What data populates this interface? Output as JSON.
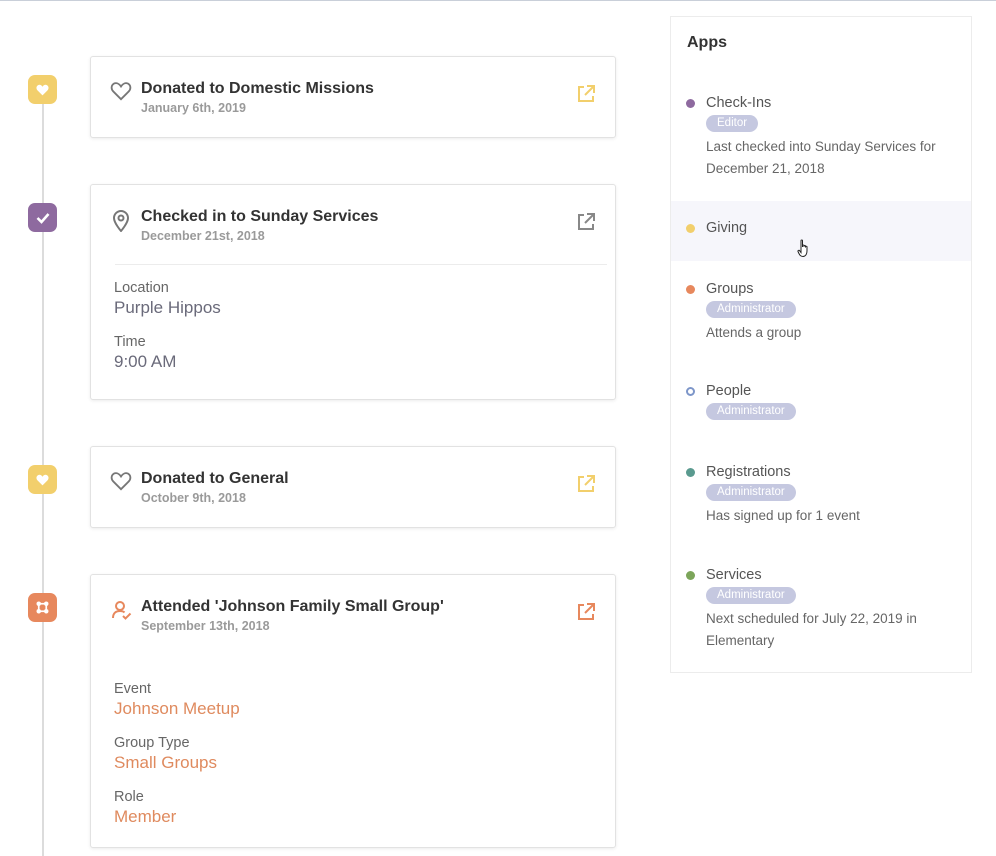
{
  "colors": {
    "giving": "#f2cf6c",
    "checkins": "#8e6a9f",
    "groups": "#e7885d",
    "people": "#7d96c9",
    "registrations": "#5a9a8f",
    "services": "#7ca55a",
    "badge": "#c5c8e0"
  },
  "timeline": [
    {
      "title": "Donated to Domestic Missions",
      "date": "January 6th, 2019",
      "dot_icon": "heart-icon",
      "type_icon": "heart-outline-icon",
      "link_icon": "external-link-icon"
    },
    {
      "title": "Checked in to Sunday Services",
      "date": "December 21st, 2018",
      "dot_icon": "check-icon",
      "type_icon": "map-pin-icon",
      "link_icon": "external-link-icon",
      "fields": [
        {
          "label": "Location",
          "value": "Purple Hippos"
        },
        {
          "label": "Time",
          "value": "9:00 AM"
        }
      ]
    },
    {
      "title": "Donated to General",
      "date": "October 9th, 2018",
      "dot_icon": "heart-icon",
      "type_icon": "heart-outline-icon",
      "link_icon": "external-link-icon"
    },
    {
      "title": "Attended 'Johnson Family Small Group'",
      "date": "September 13th, 2018",
      "dot_icon": "groups-icon",
      "type_icon": "person-group-icon",
      "link_icon": "external-link-icon",
      "fields": [
        {
          "label": "Event",
          "value": "Johnson Meetup"
        },
        {
          "label": "Group Type",
          "value": "Small Groups"
        },
        {
          "label": "Role",
          "value": "Member"
        }
      ]
    }
  ],
  "apps": {
    "title": "Apps",
    "items": [
      {
        "name": "Check-Ins",
        "badge": "Editor",
        "description": "Last checked into Sunday Services for December 21, 2018"
      },
      {
        "name": "Giving"
      },
      {
        "name": "Groups",
        "badge": "Administrator",
        "description": "Attends a group"
      },
      {
        "name": "People",
        "badge": "Administrator"
      },
      {
        "name": "Registrations",
        "badge": "Administrator",
        "description": "Has signed up for 1 event"
      },
      {
        "name": "Services",
        "badge": "Administrator",
        "description": "Next scheduled for July 22, 2019 in Elementary"
      }
    ]
  }
}
